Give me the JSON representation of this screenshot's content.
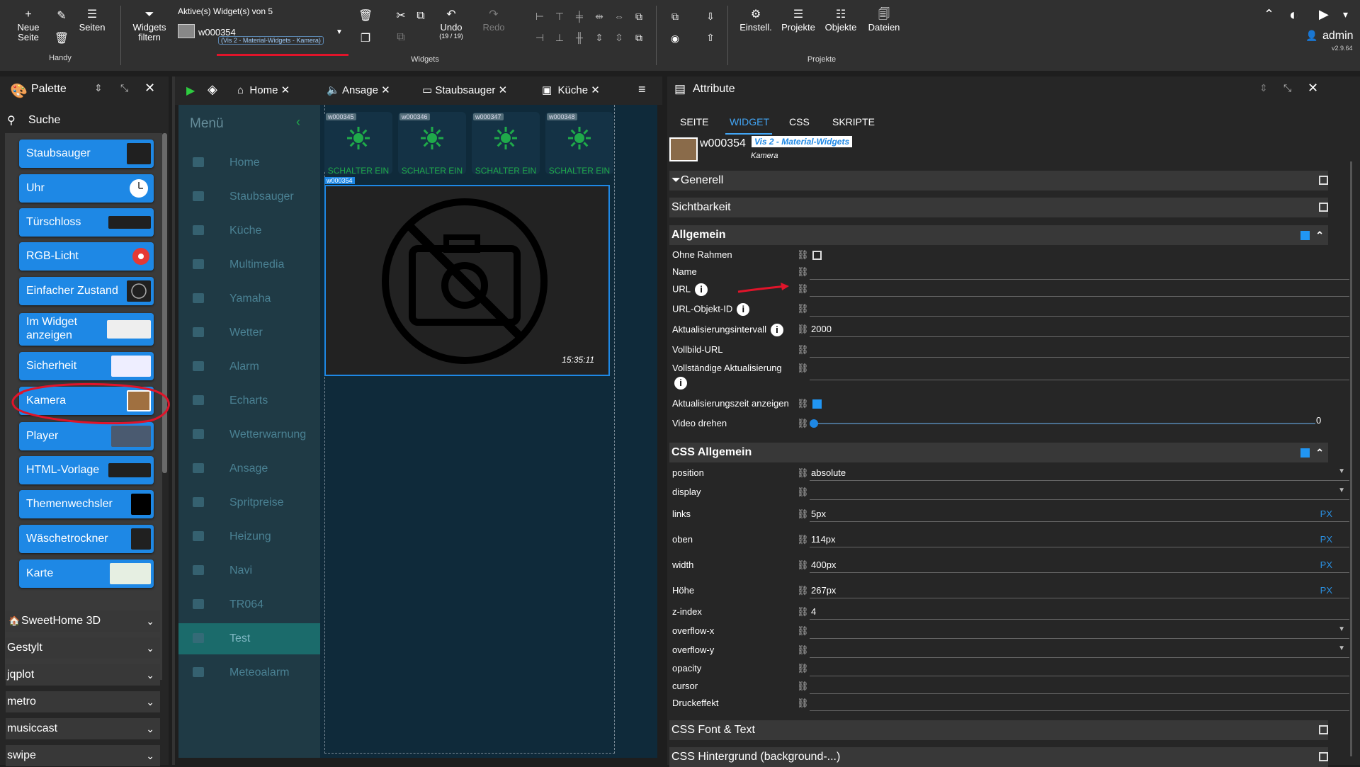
{
  "toolbar": {
    "new_page": "Neue Seite",
    "pages": "Seiten",
    "group_handy": "Handy",
    "filter": "Widgets filtern",
    "active_label": "Aktive(s) Widget(s) von 5",
    "widget_id": "w000354",
    "widget_sub": "(Vis 2 - Material-Widgets - Kamera)",
    "undo": "Undo",
    "undo_count": "(19 / 19)",
    "redo": "Redo",
    "group_widgets": "Widgets",
    "settings": "Einstell.",
    "projects": "Projekte",
    "objects": "Objekte",
    "files": "Dateien",
    "group_projects": "Projekte",
    "user": "admin",
    "version": "v2.9.64"
  },
  "palette": {
    "title": "Palette",
    "search": "Suche",
    "widgets": [
      {
        "label": "Staubsauger"
      },
      {
        "label": "Uhr"
      },
      {
        "label": "Türschloss"
      },
      {
        "label": "RGB-Licht"
      },
      {
        "label": "Einfacher Zustand"
      },
      {
        "label": "Im Widget anzeigen"
      },
      {
        "label": "Sicherheit"
      },
      {
        "label": "Kamera"
      },
      {
        "label": "Player"
      },
      {
        "label": "HTML-Vorlage"
      },
      {
        "label": "Themenwechsler"
      },
      {
        "label": "Wäschetrockner"
      },
      {
        "label": "Karte"
      }
    ],
    "groups": [
      "SweetHome 3D",
      "Gestylt",
      "jqplot",
      "metro",
      "musiccast",
      "swipe"
    ]
  },
  "view_tabs": [
    "Home",
    "Ansage",
    "Staubsauger",
    "Küche"
  ],
  "menu": {
    "title": "Menü",
    "items": [
      "Home",
      "Staubsauger",
      "Küche",
      "Multimedia",
      "Yamaha",
      "Wetter",
      "Alarm",
      "Echarts",
      "Wetterwarnung",
      "Ansage",
      "Spritpreise",
      "Heizung",
      "Navi",
      "TR064",
      "Test",
      "Meteoalarm"
    ]
  },
  "canvas": {
    "switches": [
      {
        "id": "w000345",
        "state": "SCHALTER EIN"
      },
      {
        "id": "w000346",
        "state": "SCHALTER EIN"
      },
      {
        "id": "w000347",
        "state": "SCHALTER EIN"
      },
      {
        "id": "w000348",
        "state": "SCHALTER EIN"
      }
    ],
    "camera_id": "w000354",
    "camera_time": "15:35:11"
  },
  "attributes": {
    "title": "Attribute",
    "tabs": [
      "SEITE",
      "WIDGET",
      "CSS",
      "SKRIPTE"
    ],
    "widget_id": "w000354",
    "widget_set": "Vis 2 - Material-Widgets",
    "widget_type": "Kamera",
    "sect_general": "Generell",
    "sect_visibility": "Sichtbarkeit",
    "sect_common": "Allgemein",
    "common": {
      "no_frame": "Ohne Rahmen",
      "name": "Name",
      "url": "URL",
      "url_oid": "URL-Objekt-ID",
      "interval": "Aktualisierungsintervall",
      "interval_value": "2000",
      "fullscreen": "Vollbild-URL",
      "full_refresh": "Vollständige Aktualisierung",
      "show_time": "Aktualisierungszeit anzeigen",
      "rotate": "Video drehen",
      "rotate_value": "0"
    },
    "sect_css_common": "CSS Allgemein",
    "css": {
      "position": "position",
      "position_value": "absolute",
      "display": "display",
      "left": "links",
      "left_value": "5px",
      "top": "oben",
      "top_value": "114px",
      "width": "width",
      "width_value": "400px",
      "height": "Höhe",
      "height_value": "267px",
      "zindex": "z-index",
      "zindex_value": "4",
      "ox": "overflow-x",
      "oy": "overflow-y",
      "opacity": "opacity",
      "cursor": "cursor",
      "press": "Druckeffekt",
      "unit": "PX"
    },
    "sect_font": "CSS Font & Text",
    "sect_bg": "CSS Hintergrund (background-...)"
  },
  "colors": {
    "accent": "#1e88e5",
    "annotation": "#e0142a",
    "switch_on": "#1faa4a"
  }
}
